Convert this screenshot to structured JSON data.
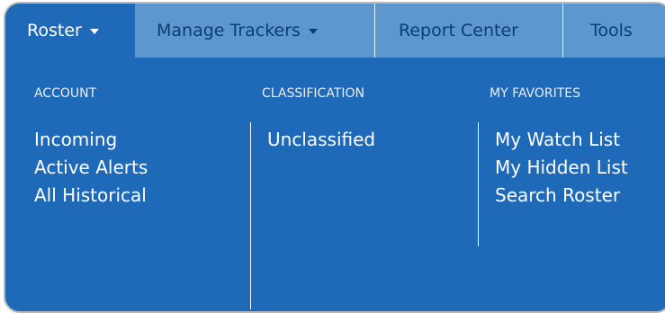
{
  "nav": {
    "tabs": [
      {
        "label": "Roster",
        "has_caret": true
      },
      {
        "label": "Manage Trackers",
        "has_caret": true
      },
      {
        "label": "Report Center",
        "has_caret": false
      },
      {
        "label": "Tools",
        "has_caret": false
      }
    ],
    "active_tab": "Roster"
  },
  "menu": {
    "columns": [
      {
        "heading": "ACCOUNT",
        "items": [
          "Incoming",
          "Active Alerts",
          "All Historical"
        ]
      },
      {
        "heading": "CLASSIFICATION",
        "items": [
          "Unclassified"
        ]
      },
      {
        "heading": "MY FAVORITES",
        "items": [
          "My Watch List",
          "My Hidden List",
          "Search Roster"
        ]
      }
    ]
  },
  "colors": {
    "menu_background": "#1e6ab8",
    "nav_background": "#5d97d0",
    "inactive_tab_text": "#0d3d73",
    "active_text": "#ffffff"
  },
  "icons": {
    "dropdown": "caret-down-icon"
  }
}
